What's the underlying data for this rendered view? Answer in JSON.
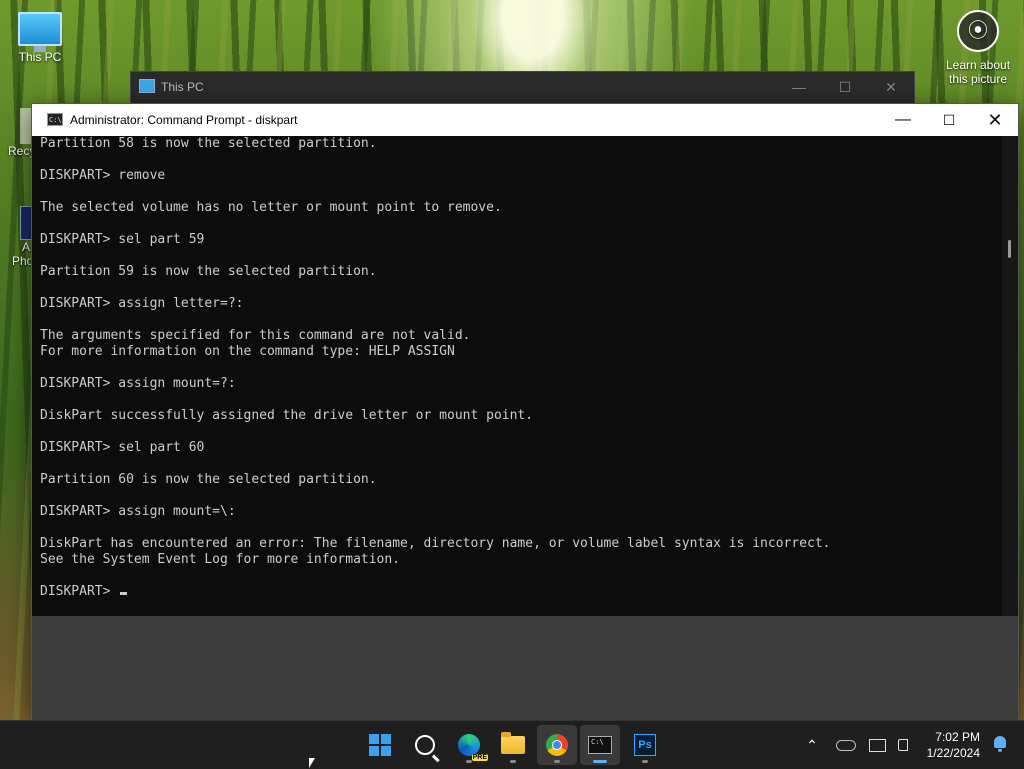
{
  "desktop": {
    "this_pc_label": "This PC",
    "learn_label": "Learn about this picture",
    "recycle_partial": "Recy",
    "photo_partial_a": "A",
    "photo_partial_b": "Pho"
  },
  "background_window": {
    "title": "This PC",
    "controls": {
      "minimize": "—",
      "maximize": "☐",
      "close": "✕"
    }
  },
  "cmd": {
    "title": "Administrator: Command Prompt - diskpart",
    "icon_text": "C:\\",
    "controls": {
      "minimize": "—",
      "maximize": "☐",
      "close": "✕"
    },
    "console_text": "Partition 58 is now the selected partition.\n\nDISKPART> remove\n\nThe selected volume has no letter or mount point to remove.\n\nDISKPART> sel part 59\n\nPartition 59 is now the selected partition.\n\nDISKPART> assign letter=?:\n\nThe arguments specified for this command are not valid.\nFor more information on the command type: HELP ASSIGN\n\nDISKPART> assign mount=?:\n\nDiskPart successfully assigned the drive letter or mount point.\n\nDISKPART> sel part 60\n\nPartition 60 is now the selected partition.\n\nDISKPART> assign mount=\\:\n\nDiskPart has encountered an error: The filename, directory name, or volume label syntax is incorrect.\nSee the System Event Log for more information.\n\nDISKPART> "
  },
  "taskbar": {
    "apps": [
      "start-icon",
      "search-icon",
      "edge-icon",
      "file-explorer-icon",
      "chrome-icon",
      "terminal-icon",
      "photoshop-icon"
    ],
    "edge_badge": "PRE",
    "term_icon_text": "C:\\",
    "ps_icon_text": "Ps",
    "tray": {
      "chevron": "⌃"
    },
    "clock": {
      "time": "7:02 PM",
      "date": "1/22/2024"
    }
  },
  "colors": {
    "console_bg": "#0c0c0c",
    "console_fg": "#cccccc",
    "taskbar_bg": "#1f1f1f",
    "accent": "#5fb2f2"
  }
}
